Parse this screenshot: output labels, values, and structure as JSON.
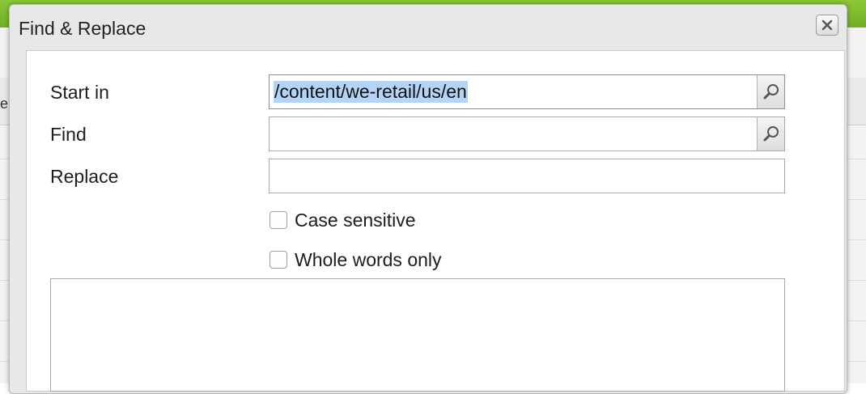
{
  "background": {
    "partial_text": "ele"
  },
  "dialog": {
    "title": "Find & Replace",
    "close_icon": "close-icon"
  },
  "form": {
    "start_in": {
      "label": "Start in",
      "value": "/content/we-retail/us/en",
      "icon": "search-icon"
    },
    "find": {
      "label": "Find",
      "value": "",
      "icon": "search-icon"
    },
    "replace": {
      "label": "Replace",
      "value": ""
    },
    "case_sensitive": {
      "label": "Case sensitive",
      "checked": false
    },
    "whole_words": {
      "label": "Whole words only",
      "checked": false
    }
  },
  "colors": {
    "top_bar": "#7ab92c",
    "selection": "#b4d4f7"
  }
}
